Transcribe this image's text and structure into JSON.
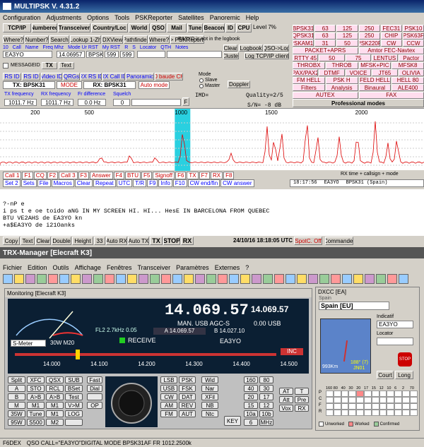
{
  "multipsk": {
    "title": "MULTIPSK V. 4.31.2",
    "menu": [
      "Configuration",
      "Adjustments",
      "Options",
      "Tools",
      "PSKReporter",
      "Satellites",
      "Panoremic",
      "Help"
    ],
    "toolbar": [
      "TCP/IP",
      "Numbered",
      "Transceiver",
      "Country/Loc",
      "World",
      "QSO",
      "Mail",
      "Tune",
      "Beacon",
      "ID",
      "CPU"
    ],
    "level": "Level 7%",
    "row2": [
      "Where?",
      "Number?",
      "Search",
      "Lookup 1-Zh",
      "DXView",
      "Pathfinder",
      "Where?",
      "--> PSKReporter"
    ],
    "qso_labels": [
      "10",
      "Call",
      "Name",
      "Freq Mhz",
      "Mode Ur RST",
      "My RST",
      "R",
      "S",
      "Locator",
      "QTH",
      "Notes"
    ],
    "qso_values": {
      "call": "EA3YO",
      "freq": "14.06957",
      "mode": "BPSK",
      "rst": "599",
      "myrst": "599"
    },
    "logbook_note": "EA3YO is not in the logbook",
    "log_buttons": [
      "Clear",
      "Logbook",
      "QSO->Log",
      "Cluster",
      "Log TCP/IP client"
    ],
    "modes": [
      [
        "BPSK31",
        "63",
        "125",
        "250",
        "FEC31",
        "PSK10"
      ],
      [
        "QPSK31",
        "63",
        "125",
        "250",
        "CHIP",
        "PSK63F"
      ],
      [
        "PSKAM10",
        "31",
        "50",
        "PSK220F",
        "CW",
        "CCW"
      ],
      [
        "PACKET+APRS",
        "Amtor FEC-Navtex"
      ],
      [
        "RTTY 45",
        "50",
        "75",
        "LENTUS",
        "Pactor"
      ],
      [
        "THROBX",
        "THROB",
        "MFSK+PIC",
        "MFSK8"
      ],
      [
        "PAX/PAX2",
        "DTMF",
        "VOICE",
        "JT65",
        "OLIVIA"
      ],
      [
        "FM HELL",
        "PSK H",
        "FELD HELL",
        "HELL 80"
      ],
      [
        "Filters",
        "Analysis",
        "Binaural",
        "ALE400"
      ],
      [
        "AUTEX",
        "FAX"
      ]
    ],
    "professional_modes": "Professional modes",
    "messageid": "MESSAGEID",
    "tx_label": "TX",
    "text_label": "Text",
    "rxid_row": [
      "RS ID",
      "RS ID",
      "Video ID",
      "QRGs",
      "RX RS ID",
      "RX Call ID",
      "Panoramic",
      "300 baude CHIP"
    ],
    "tx_mode": "TX: BPSK31",
    "rx_mode": "RX: BPSK31",
    "mode_label": "MODE",
    "auto_mode": "Auto mode",
    "node": "Mode",
    "slave": "Slave",
    "master": "Master",
    "doppler": "Doppler",
    "freq_labels": {
      "tx": "TX frequency",
      "rx": "RX frequency",
      "fr": "Fr difference",
      "squelch": "Squelch"
    },
    "freq_values": {
      "tx": "1011.7 Hz",
      "rx": "1011.7 Hz",
      "fr": "0.0 Hz",
      "squelch": "0"
    },
    "imd": "IMD=",
    "quality": "Quality=2/5",
    "sn": "S/N= -8 dB",
    "scale": [
      "200",
      "500",
      "1000",
      "1500",
      "2000"
    ],
    "spectrum_peaks": [
      {
        "f": 560,
        "h": 0.12
      },
      {
        "f": 720,
        "h": 0.15
      },
      {
        "f": 860,
        "h": 0.1
      },
      {
        "f": 1010,
        "h": 0.45
      },
      {
        "f": 1020,
        "h": 0.3
      },
      {
        "f": 1280,
        "h": 0.2
      },
      {
        "f": 1480,
        "h": 0.75
      },
      {
        "f": 1520,
        "h": 0.5
      },
      {
        "f": 1560,
        "h": 0.65
      },
      {
        "f": 1700,
        "h": 0.9
      },
      {
        "f": 1760,
        "h": 0.55
      },
      {
        "f": 1880,
        "h": 0.55
      },
      {
        "f": 1980,
        "h": 0.6
      },
      {
        "f": 2080,
        "h": 0.85
      },
      {
        "f": 2150,
        "h": 0.4
      },
      {
        "f": 2200,
        "h": 0.5
      }
    ],
    "fkeys1": [
      "Call 1",
      "F1",
      "CQ",
      "F2",
      "Call 3",
      "F3",
      "Answer",
      "F4",
      "BTU",
      "F5",
      "Signoff",
      "F6",
      "TX",
      "F7",
      "RX",
      "F8"
    ],
    "fkeys2": [
      "Set 2",
      "Sets",
      "File",
      "Macros",
      "Clear",
      "Repeat",
      "UTC",
      "T/R",
      "F9",
      "Info",
      "F10",
      "CW end/fin",
      "CW answer"
    ],
    "rx_time_label": "RX time + callsign + mode",
    "rx_log": {
      "time": "18:17:56",
      "call": "EA3YO",
      "mode": "BPSK31 (Spain)"
    },
    "rx_lines": [
      "?-nP e",
      "i ps t e oe toido  aNG IN MY SCREEN HI. HI... HesE IN BARCELONA FROM QUEBEC",
      "BTU VE2AHS de EA3YO kn",
      "+a$EA3YO de i21Oanks"
    ],
    "bottom_buttons": [
      "Copy",
      "Text",
      "Clear",
      "Double",
      "Height",
      "33",
      "Auto RX",
      "Auto TX",
      "TX",
      "STOP",
      "RX"
    ],
    "datetime": "24/10/16 18:18:05 UTC",
    "spotc": "SpotC. Off",
    "commander": "Commander"
  },
  "trx": {
    "title": "TRX-Manager [Elecraft K3]",
    "menu": [
      "Fichier",
      "Edition",
      "Outils",
      "Affichage",
      "Fenêtres",
      "Transceiver",
      "Paramètres",
      "Externes",
      "?"
    ],
    "monitor_title": "Monitoring [Elecraft K3]",
    "freq_main": "14.069.57",
    "freq_small": "14.069.57",
    "mode_line": "MAN. USB AGC-S",
    "db": "0.00 USB",
    "vfo_a": "A 14.069.57",
    "vfo_b": "B 14.027.10",
    "fl2": "FL2 2.7kHz 0.05",
    "receive": "RECEIVE",
    "callsign": "EA3YO",
    "smeter_label": "S-Meter",
    "power": "30W M20",
    "inc": "INC",
    "band_scale": [
      "14.000",
      "14.100",
      "14.200",
      "14.300",
      "14.400",
      "14.500"
    ],
    "left_keys": [
      [
        "Split",
        "XFC",
        "QSX",
        "SUB"
      ],
      [
        "A",
        "STO",
        "RCL",
        "BSet"
      ],
      [
        "B",
        "A>B",
        "A>B",
        "Test"
      ],
      [
        "M",
        "M1",
        "M1",
        "V>M"
      ],
      [
        "35W",
        "Tune",
        "M1",
        "LOG"
      ],
      [
        "95W",
        "S500",
        "M2",
        ""
      ]
    ],
    "mid_keys": [
      "Fast",
      "Dial",
      "",
      "OP"
    ],
    "mode_keys": [
      [
        "LSB",
        "PSK"
      ],
      [
        "USB",
        "FSK"
      ],
      [
        "CW",
        "DAT"
      ],
      [
        "AM",
        "REV"
      ],
      [
        "FM",
        "AUT"
      ]
    ],
    "bw_keys": [
      "Wid",
      "Nar",
      "XFil",
      "NB",
      "Ntc"
    ],
    "num_keys": [
      [
        "160",
        "80"
      ],
      [
        "40",
        "30"
      ],
      [
        "20",
        "17"
      ],
      [
        "15",
        "12"
      ],
      [
        "10a",
        "10b"
      ],
      [
        "6",
        "MHz"
      ]
    ],
    "key_label": "KEY",
    "at_keys": [
      "AT",
      "T",
      "Att",
      "Pre",
      "Vox",
      "RX"
    ],
    "dxcc_title": "DXCC [EA]",
    "spain": "Spain",
    "country": "Spain [EU]",
    "indicatif_label": "Indicatif",
    "indicatif": "EA3YO",
    "locator_label": "Locator",
    "locator": "",
    "bearing": "188° (7)",
    "distance": "993Km",
    "grid": "JN01",
    "court": "Court",
    "long": "Long",
    "band_header": [
      "160",
      "80",
      "40",
      "30",
      "20",
      "17",
      "15",
      "12",
      "10",
      "6",
      "2",
      "70"
    ],
    "band_rows": [
      "P",
      "C",
      "F",
      "R"
    ],
    "legend": [
      "Unworked",
      "Worked",
      "Confirmed"
    ],
    "status_left": "F6DEX",
    "status_qso": "QSO  CALL=\"EA3YO\"DIGITAL MODE BPSK31AF FR 1012.2500k"
  }
}
